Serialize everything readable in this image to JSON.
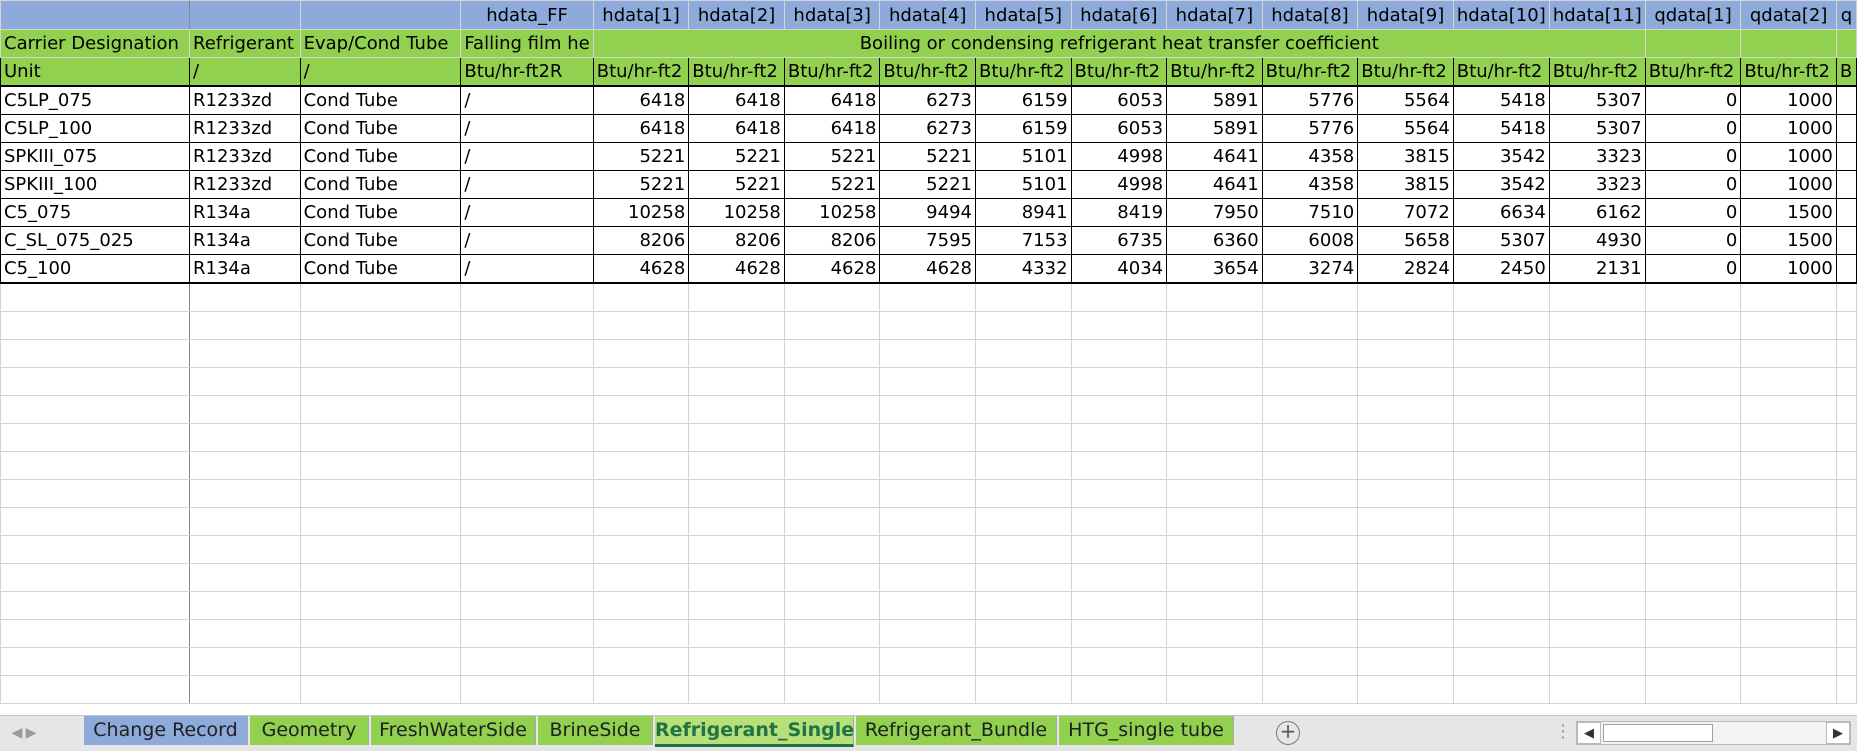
{
  "header_rows": {
    "row1": [
      "",
      "",
      "",
      "hdata_FF",
      "hdata[1]",
      "hdata[2]",
      "hdata[3]",
      "hdata[4]",
      "hdata[5]",
      "hdata[6]",
      "hdata[7]",
      "hdata[8]",
      "hdata[9]",
      "hdata[10]",
      "hdata[11]",
      "qdata[1]",
      "qdata[2]",
      "q"
    ],
    "row2": {
      "c0": "Carrier Designation",
      "c1": "Refrigerant",
      "c2": "Evap/Cond Tube",
      "c3": "Falling film he",
      "merged": "Boiling or condensing refrigerant heat transfer coefficient",
      "tail": [
        "",
        "",
        ""
      ]
    },
    "row3": [
      "Unit",
      "/",
      "/",
      "Btu/hr-ft2R",
      "Btu/hr-ft2",
      "Btu/hr-ft2",
      "Btu/hr-ft2",
      "Btu/hr-ft2",
      "Btu/hr-ft2",
      "Btu/hr-ft2",
      "Btu/hr-ft2",
      "Btu/hr-ft2",
      "Btu/hr-ft2",
      "Btu/hr-ft2",
      "Btu/hr-ft2",
      "Btu/hr-ft2",
      "Btu/hr-ft2",
      "B"
    ]
  },
  "rows": [
    [
      "C5LP_075",
      "R1233zd",
      "Cond Tube",
      "/",
      "6418",
      "6418",
      "6418",
      "6273",
      "6159",
      "6053",
      "5891",
      "5776",
      "5564",
      "5418",
      "5307",
      "0",
      "1000",
      ""
    ],
    [
      "C5LP_100",
      "R1233zd",
      "Cond Tube",
      "/",
      "6418",
      "6418",
      "6418",
      "6273",
      "6159",
      "6053",
      "5891",
      "5776",
      "5564",
      "5418",
      "5307",
      "0",
      "1000",
      ""
    ],
    [
      "SPKIII_075",
      "R1233zd",
      "Cond Tube",
      "/",
      "5221",
      "5221",
      "5221",
      "5221",
      "5101",
      "4998",
      "4641",
      "4358",
      "3815",
      "3542",
      "3323",
      "0",
      "1000",
      ""
    ],
    [
      "SPKIII_100",
      "R1233zd",
      "Cond Tube",
      "/",
      "5221",
      "5221",
      "5221",
      "5221",
      "5101",
      "4998",
      "4641",
      "4358",
      "3815",
      "3542",
      "3323",
      "0",
      "1000",
      ""
    ],
    [
      "C5_075",
      "R134a",
      "Cond Tube",
      "/",
      "10258",
      "10258",
      "10258",
      "9494",
      "8941",
      "8419",
      "7950",
      "7510",
      "7072",
      "6634",
      "6162",
      "0",
      "1500",
      ""
    ],
    [
      "C_SL_075_025",
      "R134a",
      "Cond Tube",
      "/",
      "8206",
      "8206",
      "8206",
      "7595",
      "7153",
      "6735",
      "6360",
      "6008",
      "5658",
      "5307",
      "4930",
      "0",
      "1500",
      ""
    ],
    [
      "C5_100",
      "R134a",
      "Cond Tube",
      "/",
      "4628",
      "4628",
      "4628",
      "4628",
      "4332",
      "4034",
      "3654",
      "3274",
      "2824",
      "2450",
      "2131",
      "0",
      "1000",
      ""
    ]
  ],
  "tabs": [
    {
      "label": "Change Record",
      "color": "blue"
    },
    {
      "label": "Geometry",
      "color": "green"
    },
    {
      "label": "FreshWaterSide",
      "color": "green"
    },
    {
      "label": "BrineSide",
      "color": "green"
    },
    {
      "label": "Refrigerant_Single",
      "color": "green",
      "active": true
    },
    {
      "label": "Refrigerant_Bundle",
      "color": "green"
    },
    {
      "label": "HTG_single tube",
      "color": "green"
    }
  ],
  "tabbar": {
    "add_symbol": "+",
    "scroll_left": "◀",
    "scroll_right": "▶",
    "split_symbol": "⋮",
    "nav_prev": "◀",
    "nav_next": "▶"
  }
}
